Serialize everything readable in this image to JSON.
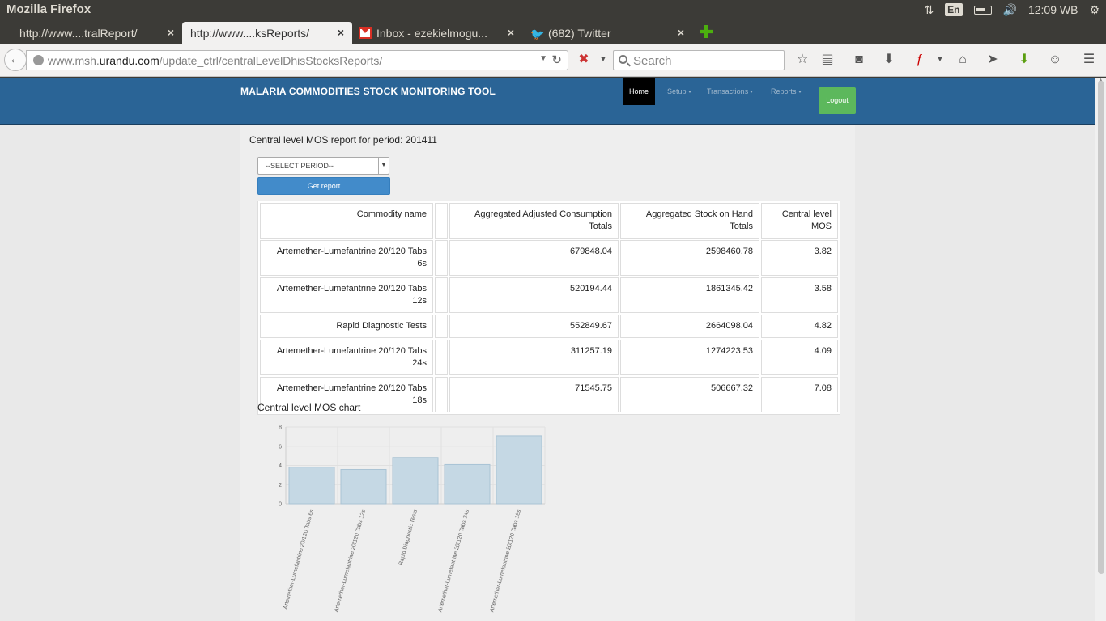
{
  "os": {
    "window_title": "Mozilla Firefox",
    "lang": "En",
    "clock": "12:09 WB"
  },
  "tabs": [
    {
      "label": "http://www....tralReport/",
      "active": false
    },
    {
      "label": "http://www....ksReports/",
      "active": true
    },
    {
      "label": "Inbox - ezekielmogu...",
      "active": false
    },
    {
      "label": "(682) Twitter",
      "active": false
    }
  ],
  "nav": {
    "url_prefix": "www.msh.",
    "url_domain": "urandu.com",
    "url_path": "/update_ctrl/centralLevelDhisStocksReports/",
    "search_placeholder": "Search"
  },
  "app": {
    "title": "MALARIA COMMODITIES STOCK MONITORING TOOL",
    "menu": {
      "home": "Home",
      "setup": "Setup",
      "transactions": "Transactions",
      "reports": "Reports",
      "logout": "Logout"
    }
  },
  "report": {
    "heading": "Central level MOS report for period: 201411",
    "select_placeholder": "--SELECT PERIOD--",
    "get_button": "Get report",
    "columns": {
      "commodity": "Commodity name",
      "consumption_l1": "Aggregated Adjusted Consumption",
      "consumption_l2": "Totals",
      "stock_l1": "Aggregated Stock on Hand",
      "stock_l2": "Totals",
      "mos_l1": "Central level",
      "mos_l2": "MOS"
    },
    "rows": [
      {
        "name_l1": "Artemether-Lumefantrine 20/120 Tabs 6s",
        "name_l2": "",
        "consumption": "679848.04",
        "stock": "2598460.78",
        "mos": "3.82"
      },
      {
        "name_l1": "Artemether-Lumefantrine 20/120 Tabs",
        "name_l2": "12s",
        "consumption": "520194.44",
        "stock": "1861345.42",
        "mos": "3.58"
      },
      {
        "name_l1": "Rapid Diagnostic Tests",
        "name_l2": "",
        "consumption": "552849.67",
        "stock": "2664098.04",
        "mos": "4.82"
      },
      {
        "name_l1": "Artemether-Lumefantrine 20/120 Tabs",
        "name_l2": "24s",
        "consumption": "311257.19",
        "stock": "1274223.53",
        "mos": "4.09"
      },
      {
        "name_l1": "Artemether-Lumefantrine 20/120 Tabs",
        "name_l2": "18s",
        "consumption": "71545.75",
        "stock": "506667.32",
        "mos": "7.08"
      }
    ]
  },
  "chart_title": "Central level MOS chart",
  "chart_data": {
    "type": "bar",
    "categories": [
      "Artemether-Lumefantrine 20/120 Tabs 6s",
      "Artemether-Lumefantrine 20/120 Tabs 12s",
      "Rapid Diagnostic Tests",
      "Artemether-Lumefantrine 20/120 Tabs 24s",
      "Artemether-Lumefantrine 20/120 Tabs 18s"
    ],
    "values": [
      3.82,
      3.58,
      4.82,
      4.09,
      7.08
    ],
    "yticks": [
      0,
      2,
      4,
      6,
      8
    ],
    "ylim": [
      0,
      8
    ],
    "grid": true,
    "bar_fill": "#c5d8e4",
    "bar_stroke": "#a9c3d4"
  }
}
